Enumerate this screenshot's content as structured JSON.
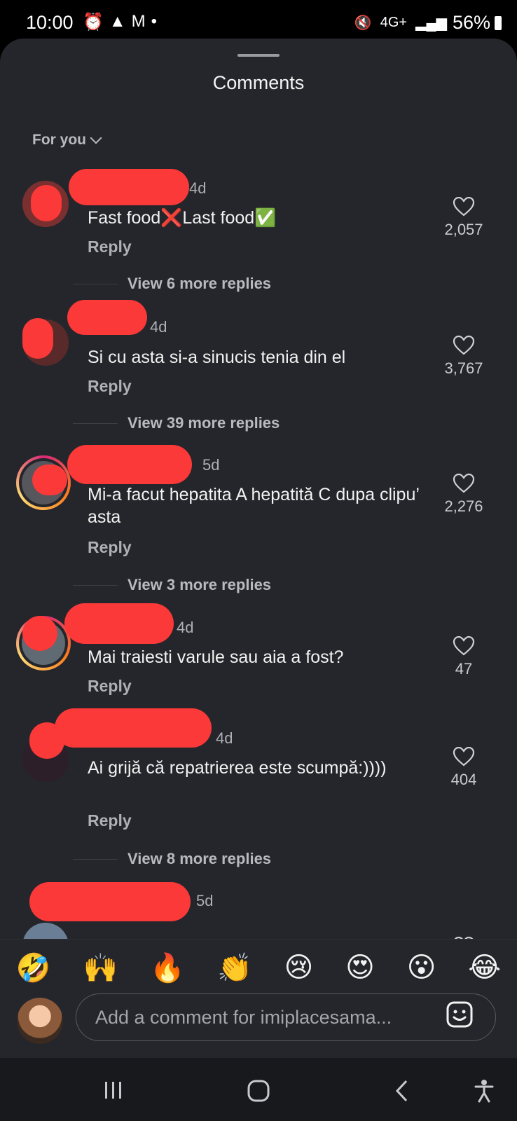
{
  "status_bar": {
    "time": "10:00",
    "battery": "56%",
    "network": "4G+"
  },
  "sheet": {
    "title": "Comments",
    "filter": "For you"
  },
  "comments": [
    {
      "time": "4d",
      "text": "Fast food❌Last food✅",
      "likes": "2,057",
      "reply": "Reply",
      "more": "View 6 more replies"
    },
    {
      "time": "4d",
      "text": "Si cu asta si-a sinucis tenia din el",
      "likes": "3,767",
      "reply": "Reply",
      "more": "View 39 more replies"
    },
    {
      "time": "5d",
      "text": "Mi-a facut hepatita A hepatită C dupa clipu’ asta",
      "likes": "2,276",
      "reply": "Reply",
      "more": "View 3 more replies"
    },
    {
      "time": "4d",
      "text": "Mai traiesti varule sau aia a fost?",
      "likes": "47",
      "reply": "Reply",
      "more": ""
    },
    {
      "time": "4d",
      "text": "Ai grijă că repatrierea este scumpă:))))",
      "likes": "404",
      "reply": "Reply",
      "more": "View 8 more replies"
    },
    {
      "time": "5d",
      "text": "",
      "likes": "",
      "reply": "",
      "more": ""
    }
  ],
  "emoji_bar": [
    "🤣",
    "🙌",
    "🔥",
    "👏",
    "😢",
    "😍",
    "😮",
    "😂"
  ],
  "composer": {
    "placeholder": "Add a comment for imiplacesama..."
  }
}
